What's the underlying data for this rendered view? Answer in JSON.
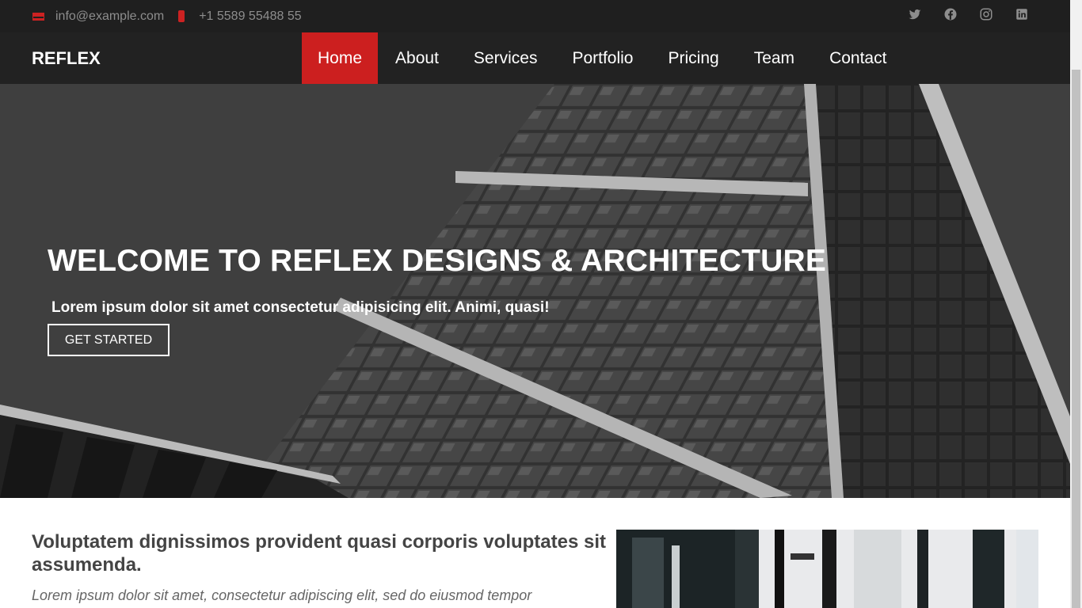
{
  "topbar": {
    "email": "info@example.com",
    "phone": "+1 5589 55488 55",
    "social": [
      "twitter-icon",
      "facebook-icon",
      "instagram-icon",
      "linkedin-icon"
    ]
  },
  "brand": "REFLEX",
  "nav": {
    "items": [
      {
        "label": "Home",
        "active": true
      },
      {
        "label": "About"
      },
      {
        "label": "Services"
      },
      {
        "label": "Portfolio"
      },
      {
        "label": "Pricing"
      },
      {
        "label": "Team"
      },
      {
        "label": "Contact"
      }
    ]
  },
  "hero": {
    "title": "WELCOME TO REFLEX DESIGNS & ARCHITECTURE",
    "subtitle": "Lorem ipsum dolor sit amet consectetur adipisicing elit. Animi, quasi!",
    "cta": "GET STARTED"
  },
  "about": {
    "heading": "Voluptatem dignissimos provident quasi corporis voluptates sit assumenda.",
    "text": "Lorem ipsum dolor sit amet, consectetur adipiscing elit, sed do eiusmod tempor"
  },
  "colors": {
    "accent": "#cc1f1f",
    "topbar": "#1f1f1f",
    "navbar": "#222222"
  }
}
